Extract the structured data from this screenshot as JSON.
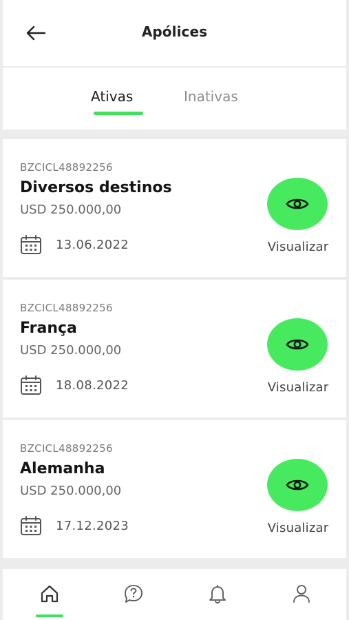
{
  "header": {
    "title": "Apólices",
    "back_icon": "arrow-left-icon"
  },
  "tabs": [
    {
      "label": "Ativas",
      "active": true
    },
    {
      "label": "Inativas",
      "active": false
    }
  ],
  "policies": [
    {
      "code": "BZCICL48892256",
      "name": "Diversos destinos",
      "amount": "USD 250.000,00",
      "date": "13.06.2022",
      "action_label": "Visualizar"
    },
    {
      "code": "BZCICL48892256",
      "name": "França",
      "amount": "USD 250.000,00",
      "date": "18.08.2022",
      "action_label": "Visualizar"
    },
    {
      "code": "BZCICL48892256",
      "name": "Alemanha",
      "amount": "USD 250.000,00",
      "date": "17.12.2023",
      "action_label": "Visualizar"
    }
  ],
  "bottom_nav": [
    {
      "icon": "home-icon",
      "active": true
    },
    {
      "icon": "help-icon",
      "active": false
    },
    {
      "icon": "bell-icon",
      "active": false
    },
    {
      "icon": "user-icon",
      "active": false
    }
  ],
  "colors": {
    "accent": "#47ea5f",
    "indicator": "#3ee25a",
    "background": "#ececec"
  }
}
